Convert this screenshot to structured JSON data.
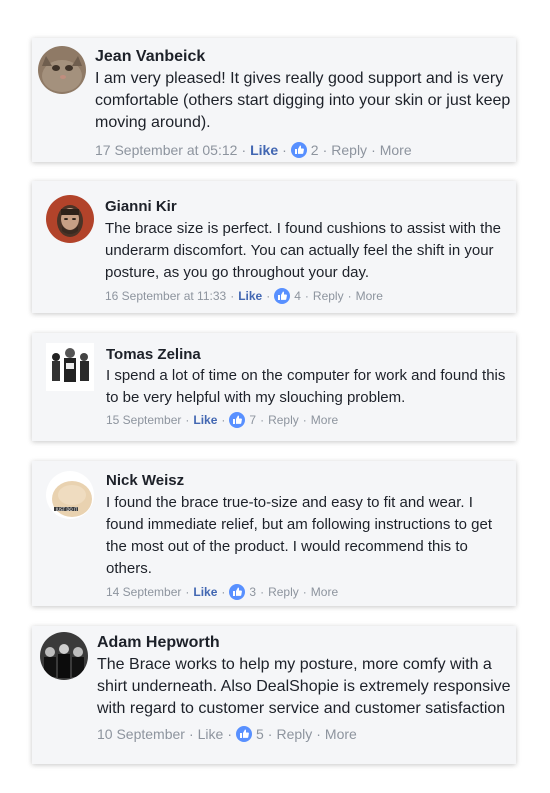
{
  "comments": [
    {
      "name": "Jean Vanbeick",
      "text": "I am very pleased! It gives really good support and is very comfortable (others start digging into your skin or just keep moving around).",
      "date": "17 September at 05:12",
      "like_label": "Like",
      "likes": "2",
      "reply_label": "Reply",
      "more_label": "More",
      "avatar_icon": "cat-photo-avatar"
    },
    {
      "name": "Gianni Kir",
      "text": "The brace size is perfect. I found cushions to assist with the underarm discomfort. You can actually feel the shift in your posture, as you go throughout your day.",
      "date": "16 September at 11:33",
      "like_label": "Like",
      "likes": "4",
      "reply_label": "Reply",
      "more_label": "More",
      "avatar_icon": "man-photo-avatar"
    },
    {
      "name": "Tomas Zelina",
      "text": "I spend a lot of time on the computer for work and found this to be very helpful with my slouching problem.",
      "date": "15 September",
      "like_label": "Like",
      "likes": "7",
      "reply_label": "Reply",
      "more_label": "More",
      "avatar_icon": "group-photo-avatar"
    },
    {
      "name": "Nick Weisz",
      "text": "I found the brace true-to-size and easy to fit and wear. I found immediate relief, but am following instructions to get the most out of the product. I would recommend this to others.",
      "date": "14 September",
      "like_label": "Like",
      "likes": "3",
      "reply_label": "Reply",
      "more_label": "More",
      "avatar_icon": "cap-photo-avatar"
    },
    {
      "name": "Adam Hepworth",
      "text": "The Brace works to help my posture, more comfy with a shirt underneath. Also DealShopie is extremely responsive with regard to customer service and customer satisfaction",
      "date": "10 September",
      "like_label": "Like",
      "likes": "5",
      "reply_label": "Reply",
      "more_label": "More",
      "avatar_icon": "band-photo-avatar"
    }
  ],
  "colors": {
    "card_bg": "#f5f6f8",
    "link_blue": "#4267b2",
    "meta_gray": "#8d949e",
    "text": "#1d2129",
    "like_badge": "#5890ff"
  }
}
